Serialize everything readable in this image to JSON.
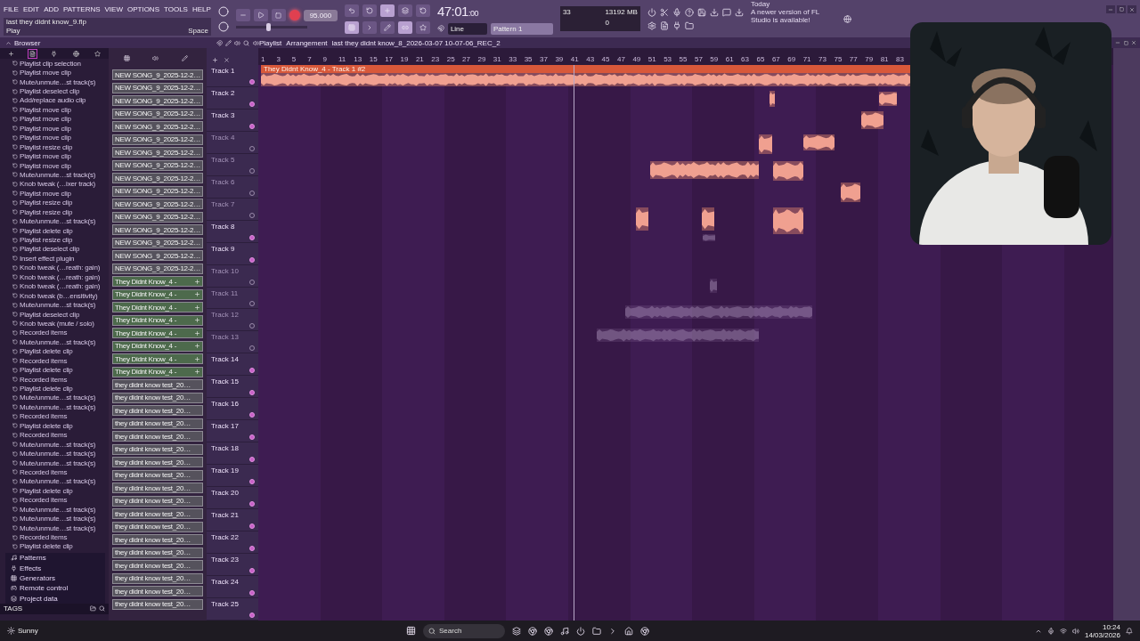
{
  "menu": [
    "FILE",
    "EDIT",
    "ADD",
    "PATTERNS",
    "VIEW",
    "OPTIONS",
    "TOOLS",
    "HELP"
  ],
  "hint": {
    "title": "last they didnt know_9.flp",
    "action": "Play",
    "shortcut": "Space"
  },
  "transport": {
    "recording": true
  },
  "master_volume": {
    "level": 0.45
  },
  "tempo": "95.000",
  "time": {
    "main": "47:01",
    "sub": ":00"
  },
  "snap": "Line",
  "pattern": "Pattern 1",
  "cpu": {
    "cores": "33",
    "memory": "13192 MB",
    "polyphony": "0"
  },
  "news": {
    "when": "Today",
    "text": "A newer version of FL Studio is available!"
  },
  "browser": {
    "title": "Browser",
    "history": [
      "Playlist clip selection",
      "Playlist move clip",
      "Mute/unmute…st track(s)",
      "Playlist deselect clip",
      "Add/replace audio clip",
      "Playlist move clip",
      "Playlist move clip",
      "Playlist move clip",
      "Playlist move clip",
      "Playlist resize clip",
      "Playlist move clip",
      "Playlist move clip",
      "Mute/unmute…st track(s)",
      "Knob tweak (…ixer track)",
      "Playlist move clip",
      "Playlist resize clip",
      "Playlist resize clip",
      "Mute/unmute…st track(s)",
      "Playlist delete clip",
      "Playlist resize clip",
      "Playlist deselect clip",
      "Insert effect plugin",
      "Knob tweak (…reath: gain)",
      "Knob tweak (…reath: gain)",
      "Knob tweak (…reath: gain)",
      "Knob tweak (b…ensitivity)",
      "Mute/unmute…st track(s)",
      "Playlist deselect clip",
      "Knob tweak (mute / solo)",
      "Recorded items",
      "Mute/unmute…st track(s)",
      "Playlist delete clip",
      "Recorded items",
      "Playlist delete clip",
      "Recorded items",
      "Playlist delete clip",
      "Mute/unmute…st track(s)",
      "Mute/unmute…st track(s)",
      "Recorded items",
      "Playlist delete clip",
      "Recorded items",
      "Mute/unmute…st track(s)",
      "Mute/unmute…st track(s)",
      "Mute/unmute…st track(s)",
      "Recorded items",
      "Mute/unmute…st track(s)",
      "Playlist delete clip",
      "Recorded items",
      "Mute/unmute…st track(s)",
      "Mute/unmute…st track(s)",
      "Mute/unmute…st track(s)",
      "Recorded items",
      "Playlist delete clip"
    ],
    "folders": [
      {
        "label": "Patterns",
        "kind": "patterns"
      },
      {
        "label": "Effects",
        "kind": "effects"
      },
      {
        "label": "Generators",
        "kind": "generators"
      },
      {
        "label": "Remote control",
        "kind": "remote"
      },
      {
        "label": "Project data",
        "kind": "project"
      }
    ],
    "tags": "TAGS"
  },
  "breadcrumb": [
    "Playlist",
    "Arrangement",
    "last they didnt know_8_2026-03-07 10-07-06_REC_2"
  ],
  "clip_source": [
    {
      "label": "NEW SONG_9_2025-12-2…",
      "kind": "audio"
    },
    {
      "label": "NEW SONG_9_2025-12-2…",
      "kind": "audio"
    },
    {
      "label": "NEW SONG_9_2025-12-2…",
      "kind": "audio"
    },
    {
      "label": "NEW SONG_9_2025-12-2…",
      "kind": "audio"
    },
    {
      "label": "NEW SONG_9_2025-12-2…",
      "kind": "audio"
    },
    {
      "label": "NEW SONG_9_2025-12-2…",
      "kind": "audio"
    },
    {
      "label": "NEW SONG_9_2025-12-2…",
      "kind": "audio"
    },
    {
      "label": "NEW SONG_9_2025-12-2…",
      "kind": "audio"
    },
    {
      "label": "NEW SONG_9_2025-12-2…",
      "kind": "audio"
    },
    {
      "label": "NEW SONG_9_2025-12-2…",
      "kind": "audio"
    },
    {
      "label": "NEW SONG_9_2025-12-2…",
      "kind": "audio"
    },
    {
      "label": "NEW SONG_9_2025-12-2…",
      "kind": "audio"
    },
    {
      "label": "NEW SONG_9_2025-12-2…",
      "kind": "audio"
    },
    {
      "label": "NEW SONG_9_2025-12-2…",
      "kind": "audio"
    },
    {
      "label": "NEW SONG_9_2025-12-2…",
      "kind": "audio"
    },
    {
      "label": "NEW SONG_9_2025-12-2…",
      "kind": "audio"
    },
    {
      "label": "They Didnt Know_4 -",
      "kind": "linked"
    },
    {
      "label": "They Didnt Know_4 -",
      "kind": "linked"
    },
    {
      "label": "They Didnt Know_4 -",
      "kind": "linked"
    },
    {
      "label": "They Didnt Know_4 -",
      "kind": "linked"
    },
    {
      "label": "They Didnt Know_4 -",
      "kind": "linked"
    },
    {
      "label": "They Didnt Know_4 -",
      "kind": "linked"
    },
    {
      "label": "They Didnt Know_4 -",
      "kind": "linked"
    },
    {
      "label": "They Didnt Know_4 -",
      "kind": "linked"
    },
    {
      "label": "they didnt know test_20…",
      "kind": "audio"
    },
    {
      "label": "they didnt know test_20…",
      "kind": "audio"
    },
    {
      "label": "they didnt know test_20…",
      "kind": "audio"
    },
    {
      "label": "they didnt know test_20…",
      "kind": "audio"
    },
    {
      "label": "they didnt know test_20…",
      "kind": "audio"
    },
    {
      "label": "they didnt know test_20…",
      "kind": "audio"
    },
    {
      "label": "they didnt know test_20…",
      "kind": "audio"
    },
    {
      "label": "they didnt know test_20…",
      "kind": "audio"
    },
    {
      "label": "they didnt know test_20…",
      "kind": "audio"
    },
    {
      "label": "they didnt know test_20…",
      "kind": "audio"
    },
    {
      "label": "they didnt know test_20…",
      "kind": "audio"
    },
    {
      "label": "they didnt know test_20…",
      "kind": "audio"
    },
    {
      "label": "they didnt know test_20…",
      "kind": "audio"
    },
    {
      "label": "they didnt know test_20…",
      "kind": "audio"
    },
    {
      "label": "they didnt know test_20…",
      "kind": "audio"
    },
    {
      "label": "they didnt know test_20…",
      "kind": "audio"
    },
    {
      "label": "they didnt know test_20…",
      "kind": "audio"
    },
    {
      "label": "they didnt know test_20…",
      "kind": "audio"
    }
  ],
  "tracks": [
    {
      "name": "Track 1",
      "muted": false
    },
    {
      "name": "Track 2",
      "muted": false
    },
    {
      "name": "Track 3",
      "muted": false
    },
    {
      "name": "Track 4",
      "muted": true
    },
    {
      "name": "Track 5",
      "muted": true
    },
    {
      "name": "Track 6",
      "muted": true
    },
    {
      "name": "Track 7",
      "muted": true
    },
    {
      "name": "Track 8",
      "muted": false
    },
    {
      "name": "Track 9",
      "muted": false
    },
    {
      "name": "Track 10",
      "muted": true
    },
    {
      "name": "Track 11",
      "muted": true
    },
    {
      "name": "Track 12",
      "muted": true
    },
    {
      "name": "Track 13",
      "muted": true
    },
    {
      "name": "Track 14",
      "muted": false
    },
    {
      "name": "Track 15",
      "muted": false
    },
    {
      "name": "Track 16",
      "muted": false
    },
    {
      "name": "Track 17",
      "muted": false
    },
    {
      "name": "Track 18",
      "muted": false
    },
    {
      "name": "Track 19",
      "muted": false
    },
    {
      "name": "Track 20",
      "muted": false
    },
    {
      "name": "Track 21",
      "muted": false
    },
    {
      "name": "Track 22",
      "muted": false
    },
    {
      "name": "Track 23",
      "muted": false
    },
    {
      "name": "Track 24",
      "muted": false
    },
    {
      "name": "Track 25",
      "muted": false
    }
  ],
  "ruler": [
    "1",
    "3",
    "5",
    "7",
    "9",
    "11",
    "13",
    "15",
    "17",
    "19",
    "21",
    "23",
    "25",
    "27",
    "29",
    "31",
    "33",
    "35",
    "37",
    "39",
    "41",
    "43",
    "45",
    "47",
    "49",
    "51",
    "53",
    "55",
    "57",
    "59",
    "61",
    "63",
    "65",
    "67",
    "69",
    "71",
    "73",
    "75",
    "77",
    "79",
    "81",
    "83"
  ],
  "playlist": {
    "clip": "They Didnt Know_4 - Track 1 #2"
  },
  "taskbar": {
    "weather": "Sunny",
    "search": "Search",
    "time": "10:24",
    "date": "14/03/2026"
  }
}
